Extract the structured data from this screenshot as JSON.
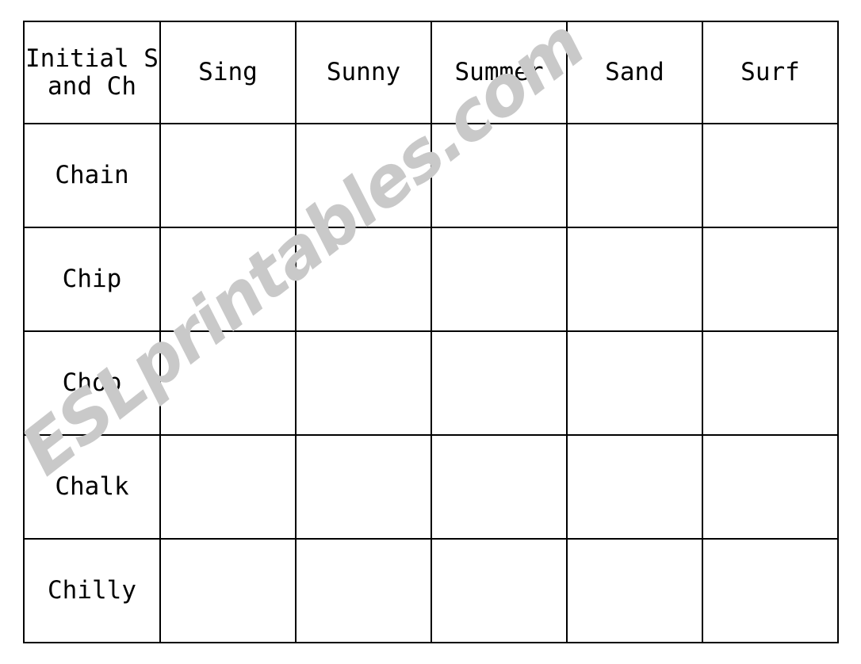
{
  "worksheet": {
    "watermark": "ESLprintables.com",
    "accent_color": "#00ec00",
    "border_color": "#000000",
    "background_color": "#ffffff",
    "watermark_color": "#c9c9c9",
    "table": {
      "corner_header": "Initial S and Ch",
      "column_headers": [
        "Sing",
        "Sunny",
        "Summer",
        "Sand",
        "Surf"
      ],
      "row_labels": [
        "Chain",
        "Chip",
        "Chop",
        "Chalk",
        "Chilly"
      ],
      "cells": [
        [
          "",
          "",
          "",
          "",
          ""
        ],
        [
          "",
          "",
          "",
          "",
          ""
        ],
        [
          "",
          "",
          "",
          "",
          ""
        ],
        [
          "",
          "",
          "",
          "",
          ""
        ],
        [
          "",
          "",
          "",
          "",
          ""
        ]
      ]
    }
  }
}
